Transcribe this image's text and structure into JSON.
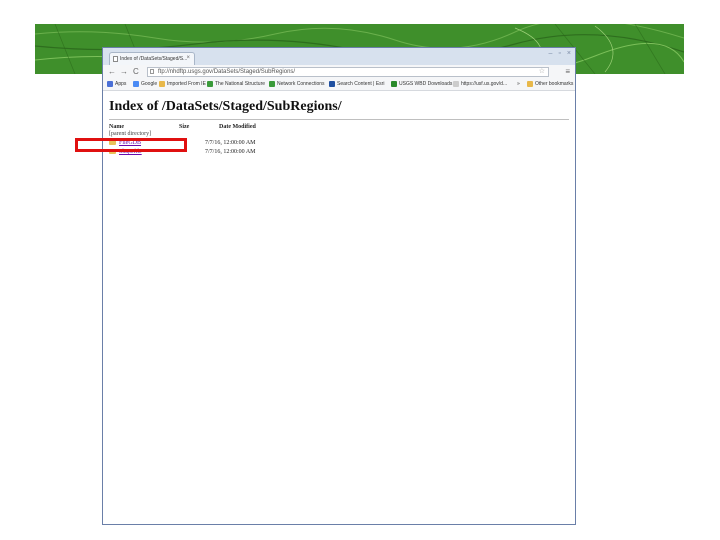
{
  "browser": {
    "tab_title": "Index of /DataSets/Staged/S...",
    "tab_close": "×",
    "window_controls": [
      "–",
      "▫",
      "×"
    ],
    "nav_back": "←",
    "nav_forward": "→",
    "nav_reload": "C",
    "address": "ftp://nhdftp.usgs.gov/DataSets/Staged/SubRegions/",
    "bookmark_star": "☆",
    "menu_glyph": "≡",
    "bookmarks": [
      {
        "label": "Apps",
        "color": "#4a6fd6"
      },
      {
        "label": "Google",
        "color": "#4a8af4"
      },
      {
        "label": "Imported From IE",
        "color": "#e8b84a"
      },
      {
        "label": "The National Structure",
        "color": "#3a9a3a"
      },
      {
        "label": "Network Connections",
        "color": "#3a9a3a"
      },
      {
        "label": "Search Content | Esri",
        "color": "#1f4fa0"
      },
      {
        "label": "USGS WBD Downloads",
        "color": "#2a8a2a"
      },
      {
        "label": "https://usf.us.gov/d...",
        "color": "#cccccc"
      },
      {
        "label": "»",
        "color": ""
      },
      {
        "label": "Other bookmarks",
        "color": "#e8b84a"
      }
    ]
  },
  "page": {
    "heading": "Index of /DataSets/Staged/SubRegions/",
    "columns": {
      "name": "Name",
      "size": "Size",
      "date": "Date Modified"
    },
    "parent_link": "[parent directory]",
    "rows": [
      {
        "name": "FileGDB",
        "date": "7/7/16, 12:00:00 AM"
      },
      {
        "name": "Shapefile",
        "date": "7/7/16, 12:00:00 AM"
      }
    ]
  },
  "colors": {
    "highlight": "#e01010",
    "banner": "#3f8f2b"
  }
}
